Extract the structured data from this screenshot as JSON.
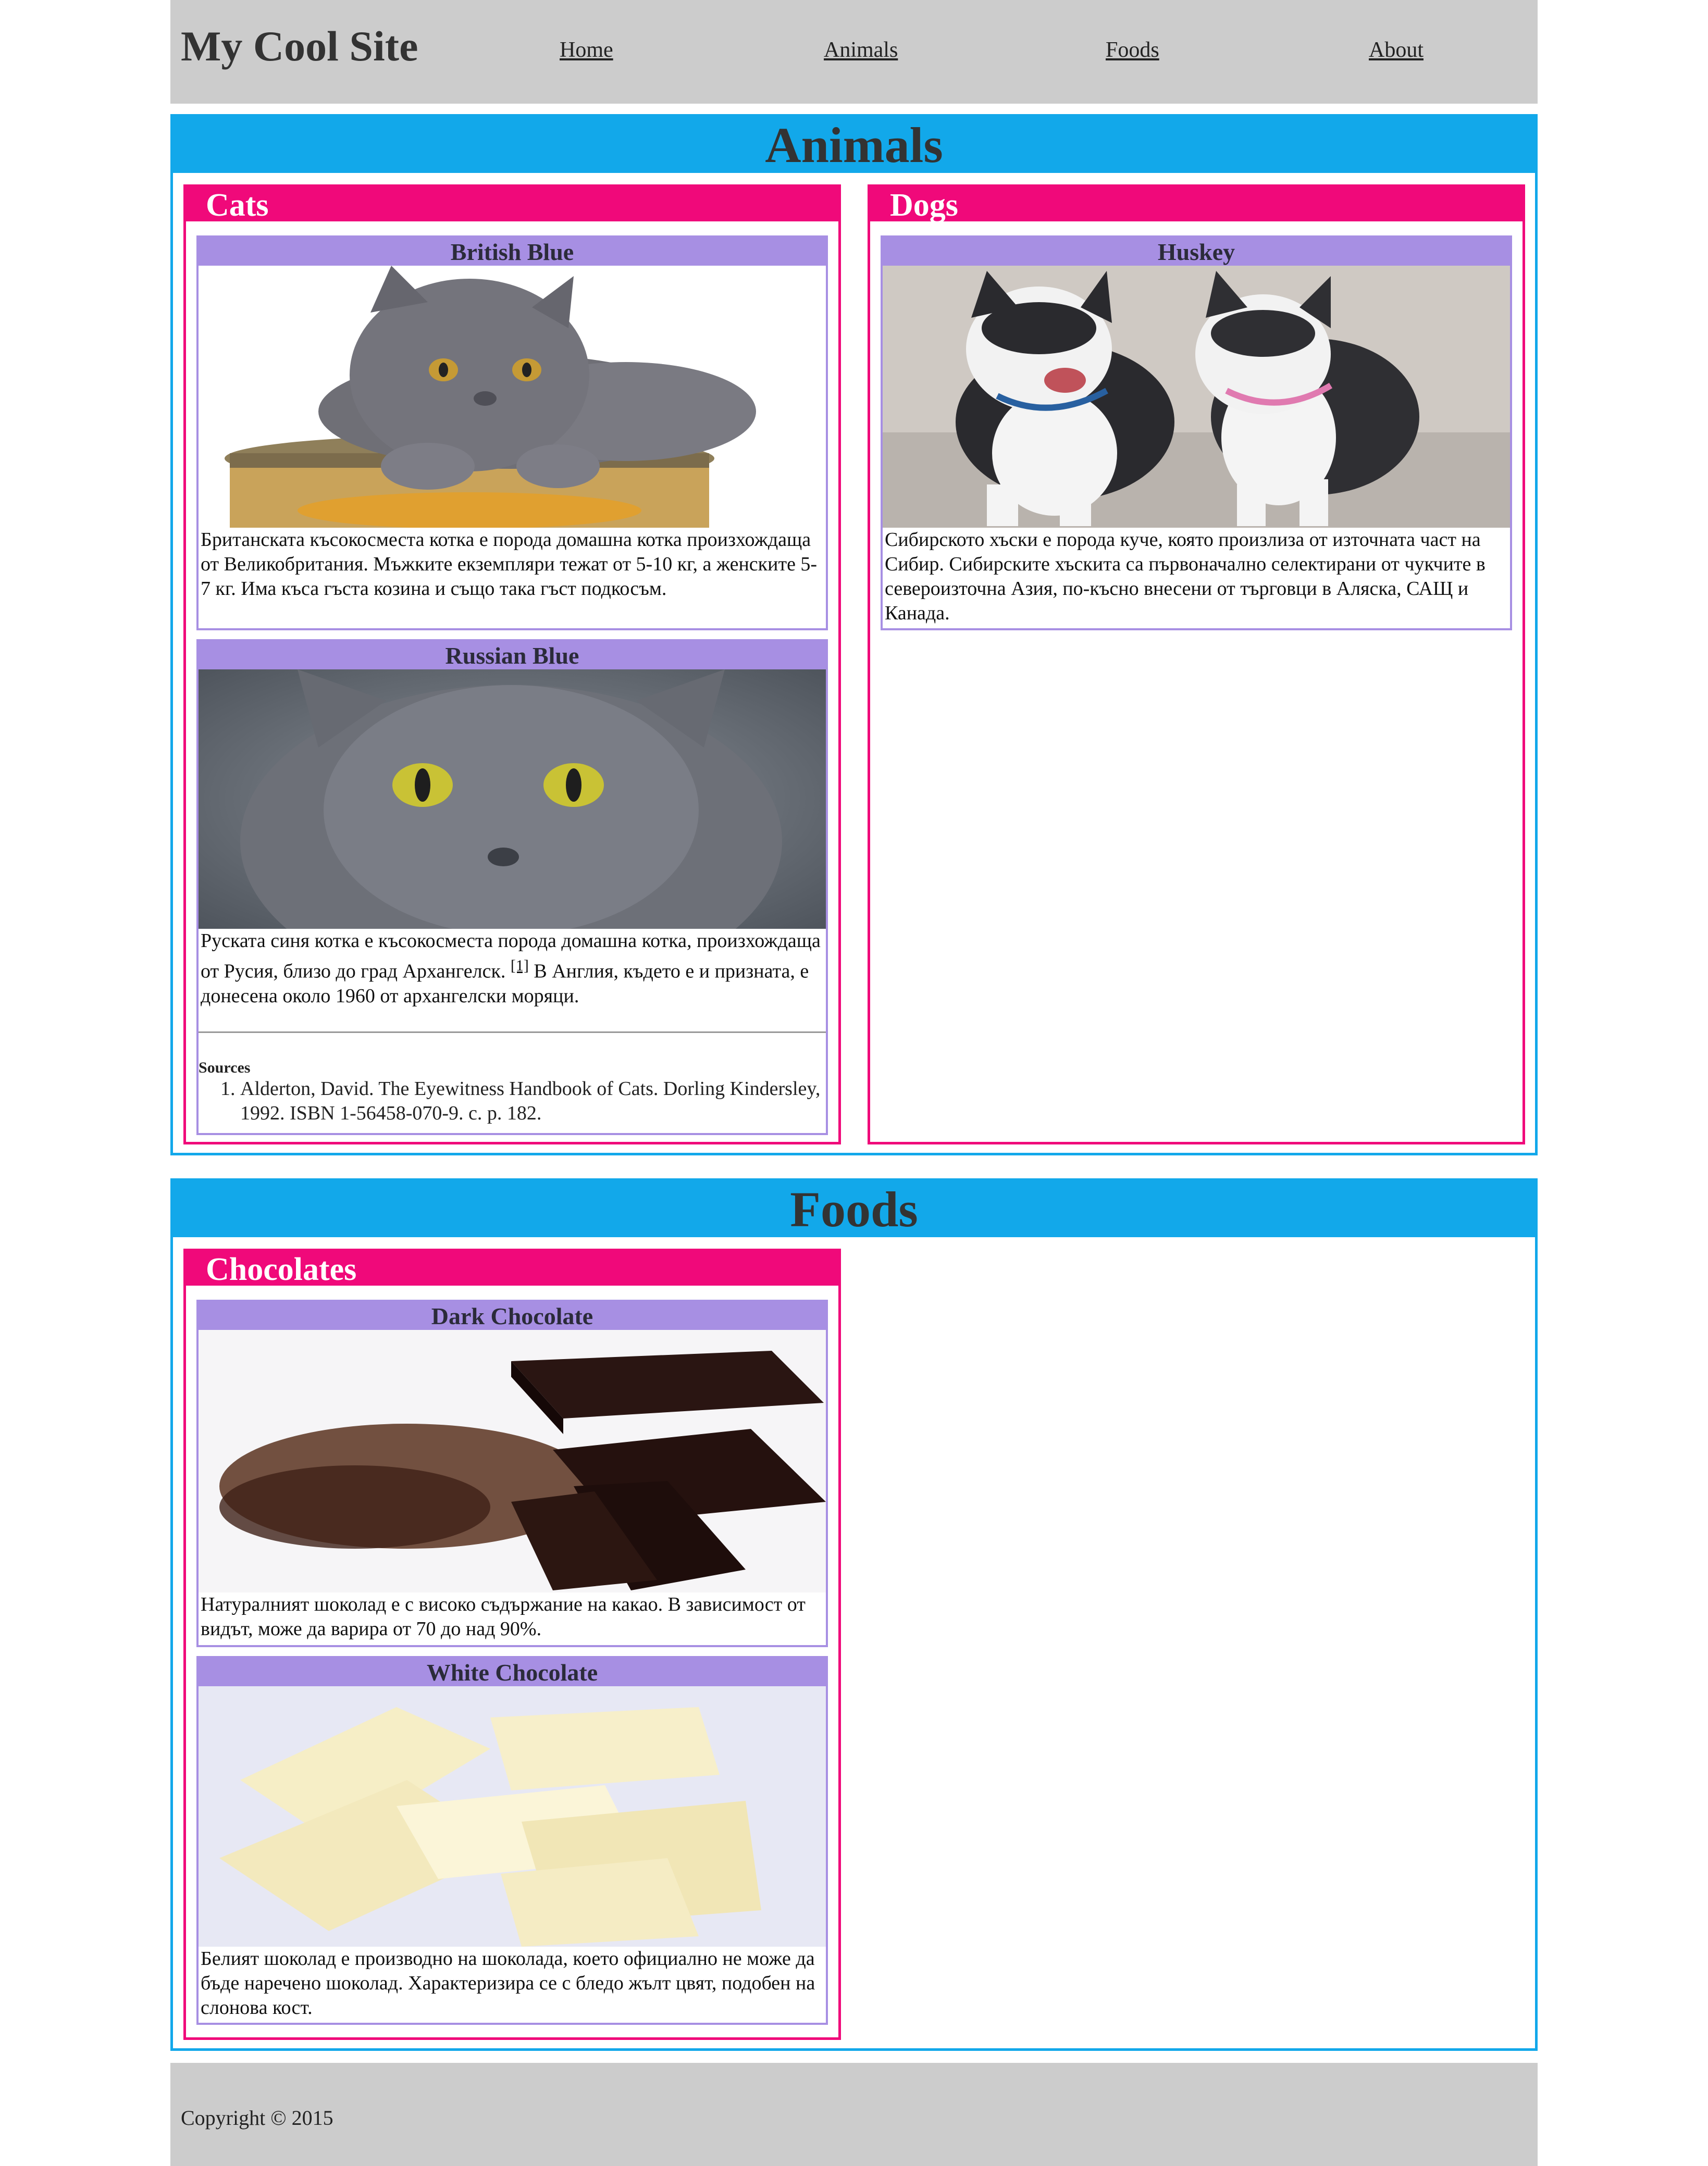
{
  "header": {
    "site_title": "My Cool Site",
    "nav": [
      "Home",
      "Animals",
      "Foods",
      "About"
    ]
  },
  "sections": {
    "animals": {
      "title": "Animals",
      "cats": {
        "title": "Cats",
        "british_blue": {
          "title": "British Blue",
          "image": "british-blue-cat-photo",
          "text": "Британската късокосместа котка е порода домашна котка произхождаща от Великобритания. Мъжките екземпляри тежат от 5-10 кг, а женските 5-7 кг. Има къса гъста козина и също така гъст подкосъм."
        },
        "russian_blue": {
          "title": "Russian Blue",
          "image": "russian-blue-cat-photo",
          "text_before": "Руската синя котка е късокосместа порода домашна котка, произхождаща от Русия, близо до град Архангелск.",
          "ref": "[1]",
          "text_after": "В Англия, където е и призната, е донесена около 1960 от архангелски моряци."
        },
        "sources": {
          "title": "Sources",
          "items": [
            "Alderton, David. The Eyewitness Handbook of Cats. Dorling Kindersley, 1992. ISBN 1-56458-070-9. с. р. 182."
          ]
        }
      },
      "dogs": {
        "title": "Dogs",
        "huskey": {
          "title": "Huskey",
          "image": "husky-puppies-photo",
          "text": "Сибирското хъски е порода куче, която произлиза от източната част на Сибир. Сибирските хъскита са първоначално селектирани от чукчите в североизточна Азия, по-късно внесени от търговци в Аляска, САЩ и Канада."
        }
      }
    },
    "foods": {
      "title": "Foods",
      "chocolates": {
        "title": "Chocolates",
        "dark": {
          "title": "Dark Chocolate",
          "image": "dark-chocolate-photo",
          "text": "Натуралният шоколад е с високо съдържание на какао. В зависимост от видът, може да варира от 70 до над 90%."
        },
        "white": {
          "title": "White Chocolate",
          "image": "white-chocolate-photo",
          "text": "Белият шоколад е производно на шоколада, което официално не може да бъде наречено шоколад. Характеризира се с бледо жълт цвят, подобен на слонова кост."
        }
      }
    }
  },
  "footer": {
    "copyright": "Copyright © 2015"
  },
  "colors": {
    "header_bg": "#cccccc",
    "section_blue": "#12a8ea",
    "category_pink": "#f0097a",
    "card_purple": "#a78fe3"
  }
}
